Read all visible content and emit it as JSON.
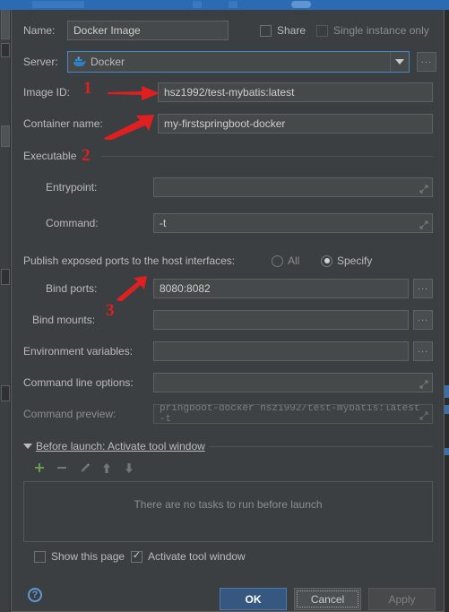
{
  "dialog": {
    "name_label": "Name:",
    "name_value": "Docker Image",
    "share_label": "Share",
    "single_instance_label": "Single instance only",
    "server_label": "Server:",
    "server_value": "Docker",
    "server_icon": "docker-whale-icon",
    "image_id_label": "Image ID:",
    "image_id_value": "hsz1992/test-mybatis:latest",
    "container_name_label": "Container name:",
    "container_name_value": "my-firstspringboot-docker",
    "executable_group_label": "Executable",
    "entrypoint_label": "Entrypoint:",
    "entrypoint_value": "",
    "command_label": "Command:",
    "command_value": "-t",
    "publish_ports_label": "Publish exposed ports to the host interfaces:",
    "radio_all_label": "All",
    "radio_specify_label": "Specify",
    "selected_publish_option": "Specify",
    "bind_ports_label": "Bind ports:",
    "bind_ports_value": "8080:8082",
    "bind_mounts_label": "Bind mounts:",
    "bind_mounts_value": "",
    "env_vars_label": "Environment variables:",
    "env_vars_value": "",
    "cmd_line_options_label": "Command line options:",
    "cmd_line_options_value": "",
    "command_preview_label": "Command preview:",
    "command_preview_value": "pringboot-docker hsz1992/test-mybatis:latest -t",
    "browse_button_label": "...",
    "expand_icon": "expand-arrows-icon"
  },
  "before_launch": {
    "header": "Before launch: Activate tool window",
    "toolbar": [
      {
        "name": "add-task-button",
        "glyph": "+",
        "color": "#6a9c4d",
        "enabled": true
      },
      {
        "name": "remove-task-button",
        "glyph": "−",
        "color": "#7c8083",
        "enabled": false
      },
      {
        "name": "edit-task-button",
        "glyph": "✎",
        "color": "#7c8083",
        "enabled": false
      },
      {
        "name": "move-up-button",
        "glyph": "↑",
        "color": "#7c8083",
        "enabled": false
      },
      {
        "name": "move-down-button",
        "glyph": "↓",
        "color": "#7c8083",
        "enabled": false
      }
    ],
    "empty_text": "There are no tasks to run before launch",
    "show_page_label": "Show this page",
    "show_page_checked": false,
    "activate_tool_window_label": "Activate tool window",
    "activate_tool_window_checked": true
  },
  "footer": {
    "help_label": "?",
    "ok_label": "OK",
    "cancel_label": "Cancel",
    "apply_label": "Apply"
  },
  "annotations": {
    "one": "1",
    "two": "2",
    "three": "3"
  },
  "colors": {
    "accent_blue": "#4a88c7",
    "title_blue": "#2d6ab4",
    "annotation_red": "#e02020",
    "dialog_bg": "#3c3f41",
    "field_bg": "#45494a",
    "ok_button": "#365880"
  }
}
